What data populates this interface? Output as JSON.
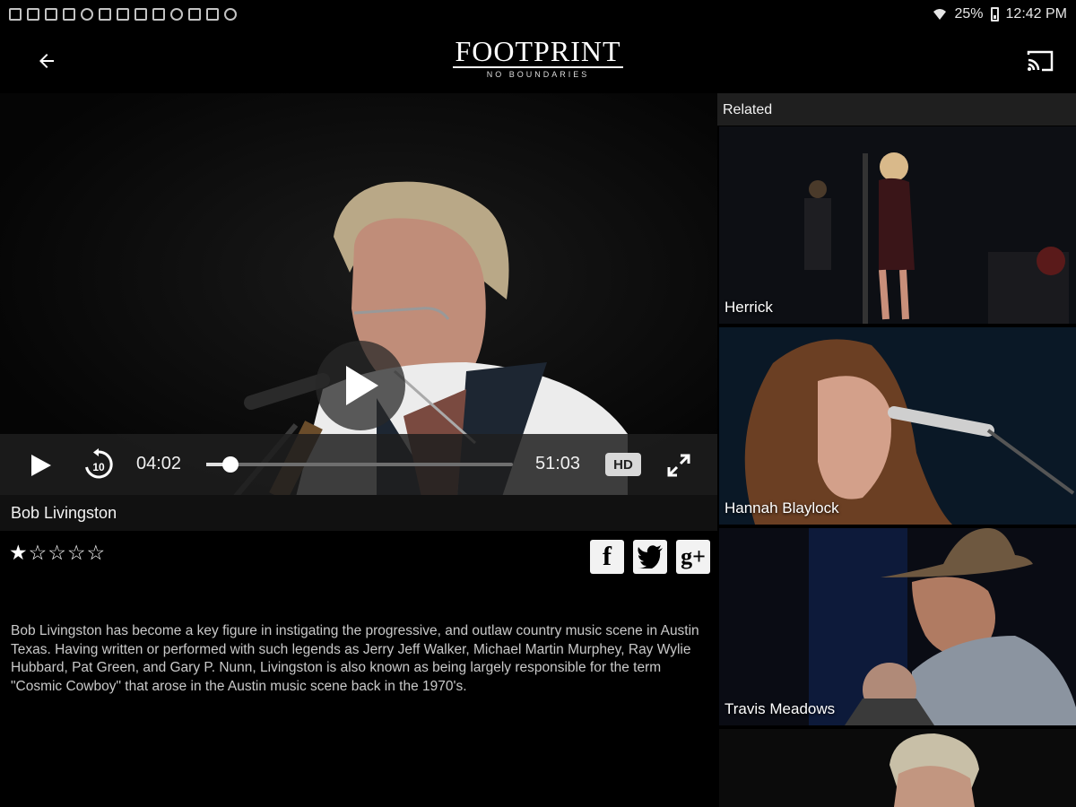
{
  "status_bar": {
    "notification_icons": [
      "gallery-icon",
      "image-icon",
      "image-icon",
      "video-icon",
      "cloud-icon",
      "download-icon",
      "car-icon",
      "flipboard-icon",
      "flipboard-icon",
      "plus-icon",
      "car-icon",
      "car-icon",
      "settings-icon"
    ],
    "battery": "25%",
    "time": "12:42 PM"
  },
  "app_bar": {
    "logo_title": "FOOTPRINT",
    "logo_subtitle": "NO BOUNDARIES"
  },
  "player": {
    "current_time": "04:02",
    "total_time": "51:03",
    "progress": 0.08,
    "replay_seconds": "10",
    "quality": "HD"
  },
  "video": {
    "title": "Bob Livingston",
    "rating": 1,
    "rating_max": 5,
    "description": "Bob Livingston has become a key figure in instigating the progressive, and outlaw country music scene in Austin Texas. Having written or performed with such legends as Jerry Jeff Walker, Michael Martin Murphey, Ray Wylie Hubbard, Pat Green, and Gary P. Nunn, Livingston is also known as being largely responsible for the term \"Cosmic Cowboy\" that arose in the Austin music scene back in the 1970's."
  },
  "share": {
    "facebook_glyph": "f",
    "google_glyph": "g+"
  },
  "related": {
    "header": "Related",
    "items": [
      {
        "label": "Herrick"
      },
      {
        "label": "Hannah Blaylock"
      },
      {
        "label": "Travis Meadows"
      },
      {
        "label": ""
      }
    ]
  }
}
